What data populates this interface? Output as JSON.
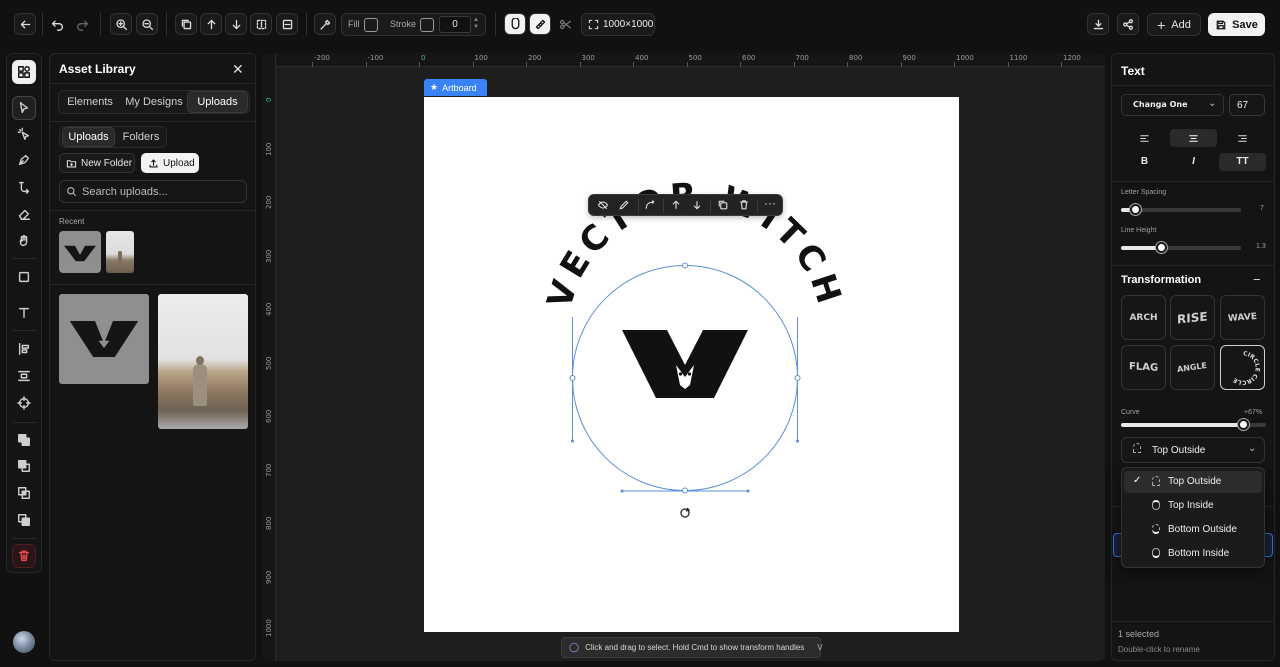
{
  "toolbar": {
    "fill_label": "Fill",
    "stroke_label": "Stroke",
    "stroke_value": "0",
    "canvas_size": "1000×1000",
    "add_label": "Add",
    "save_label": "Save"
  },
  "asset_library": {
    "title": "Asset Library",
    "tabs": [
      "Elements",
      "My Designs",
      "Uploads"
    ],
    "subtabs": [
      "Uploads",
      "Folders"
    ],
    "new_folder_label": "New Folder",
    "upload_label": "Upload",
    "search_placeholder": "Search uploads...",
    "recent_label": "Recent"
  },
  "ruler": {
    "x_ticks": [
      "-200",
      "-100",
      "0",
      "100",
      "200",
      "300",
      "400",
      "500",
      "600",
      "700",
      "800",
      "900",
      "1000",
      "1100",
      "1200"
    ],
    "y_ticks": [
      "0",
      "100",
      "200",
      "300",
      "400",
      "500",
      "600",
      "700",
      "800",
      "900",
      "1000"
    ]
  },
  "canvas": {
    "artboard_label": "Artboard",
    "curved_text": "VECTOR WITCH",
    "hint": "Click and drag to select. Hold Cmd to show transform handles",
    "hint_key": "V"
  },
  "right_panel": {
    "text_title": "Text",
    "font_name": "Changa One",
    "font_size": "67",
    "bold_label": "B",
    "italic_label": "I",
    "caps_label": "TT",
    "letter_spacing_label": "Letter Spacing",
    "letter_spacing_value": "7",
    "letter_spacing_fraction": 0.12,
    "line_height_label": "Line Height",
    "line_height_value": "1.3",
    "line_height_fraction": 0.33,
    "transformation_title": "Transformation",
    "transforms": [
      "ARCH",
      "RISE",
      "WAVE",
      "FLAG",
      "ANGLE",
      "CIRCLE"
    ],
    "curve_label": "Curve",
    "curve_value": "+67%",
    "curve_fraction": 0.84,
    "position_selected": "Top Outside",
    "position_options": [
      "Top Outside",
      "Top Inside",
      "Bottom Outside",
      "Bottom Inside"
    ],
    "selected_count": "1 selected",
    "rename_hint": "Double-click to rename"
  }
}
